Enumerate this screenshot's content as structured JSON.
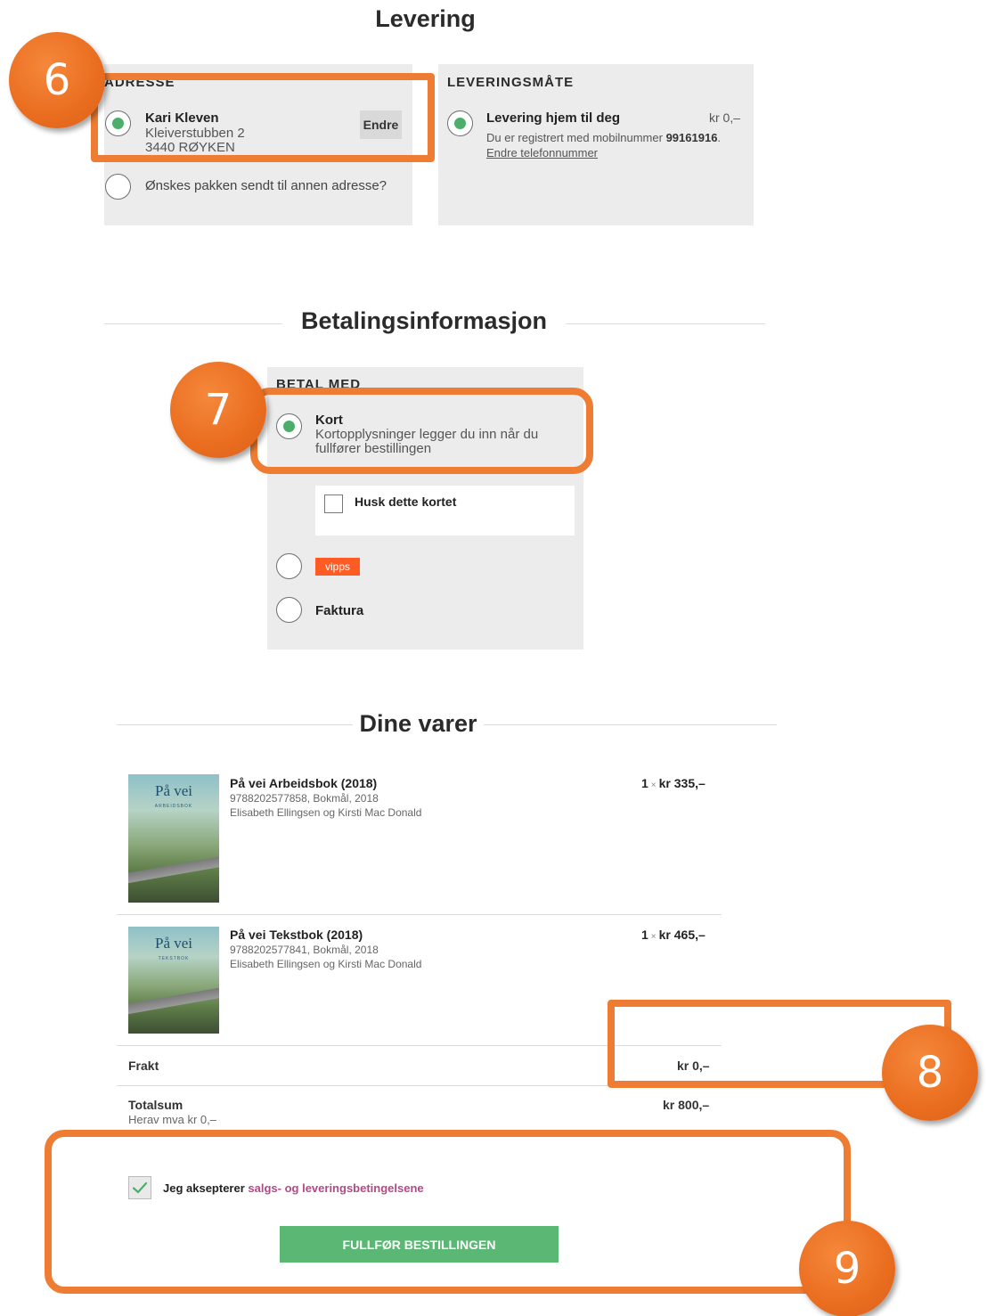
{
  "delivery": {
    "title": "Levering",
    "address_heading": "ADRESSE",
    "address": {
      "name": "Kari Kleven",
      "street": "Kleiverstubben 2",
      "postal": "3440 RØYKEN",
      "edit_label": "Endre"
    },
    "other_address_label": "Ønskes pakken sendt til annen adresse?",
    "method_heading": "LEVERINGSMÅTE",
    "method": {
      "label": "Levering hjem til deg",
      "price": "kr 0,–",
      "registered_text": "Du er registrert med mobilnummer",
      "phone": "99161916",
      "change_phone_link": "Endre telefonnummer"
    }
  },
  "payment": {
    "title": "Betalingsinformasjon",
    "heading": "BETAL MED",
    "card": {
      "label": "Kort",
      "description": "Kortopplysninger legger du inn når du fullfører bestillingen"
    },
    "remember_card_label": "Husk dette kortet",
    "vipps_label": "vipps",
    "invoice_label": "Faktura"
  },
  "cart": {
    "title": "Dine varer",
    "items": [
      {
        "title": "På vei Arbeidsbok (2018)",
        "meta": "9788202577858, Bokmål, 2018",
        "authors": "Elisabeth Ellingsen og Kirsti Mac Donald",
        "qty": "1",
        "times": "×",
        "price": "kr 335,–",
        "cover_title": "På vei",
        "cover_sub": "ARBEIDSBOK"
      },
      {
        "title": "På vei Tekstbok (2018)",
        "meta": "9788202577841, Bokmål, 2018",
        "authors": "Elisabeth Ellingsen og Kirsti Mac Donald",
        "qty": "1",
        "times": "×",
        "price": "kr 465,–",
        "cover_title": "På vei",
        "cover_sub": "TEKSTBOK"
      }
    ],
    "shipping_label": "Frakt",
    "shipping_value": "kr 0,–",
    "total_label": "Totalsum",
    "vat_label": "Herav mva kr 0,–",
    "total_value": "kr 800,–"
  },
  "terms": {
    "prefix": "Jeg aksepterer",
    "link": "salgs- og leveringsbetingelsene"
  },
  "submit_label": "FULLFØR BESTILLINGEN",
  "callouts": [
    "6",
    "7",
    "8",
    "9"
  ],
  "colors": {
    "accent_green": "#5ab774",
    "radio_green": "#4cae6a",
    "callout_orange": "#ee7d33",
    "link_pink": "#b04a86",
    "vipps_orange": "#ff5b24",
    "panel_grey": "#ececec"
  },
  "icons": {
    "check": "check-icon",
    "radio_selected": "radio-selected-icon"
  }
}
